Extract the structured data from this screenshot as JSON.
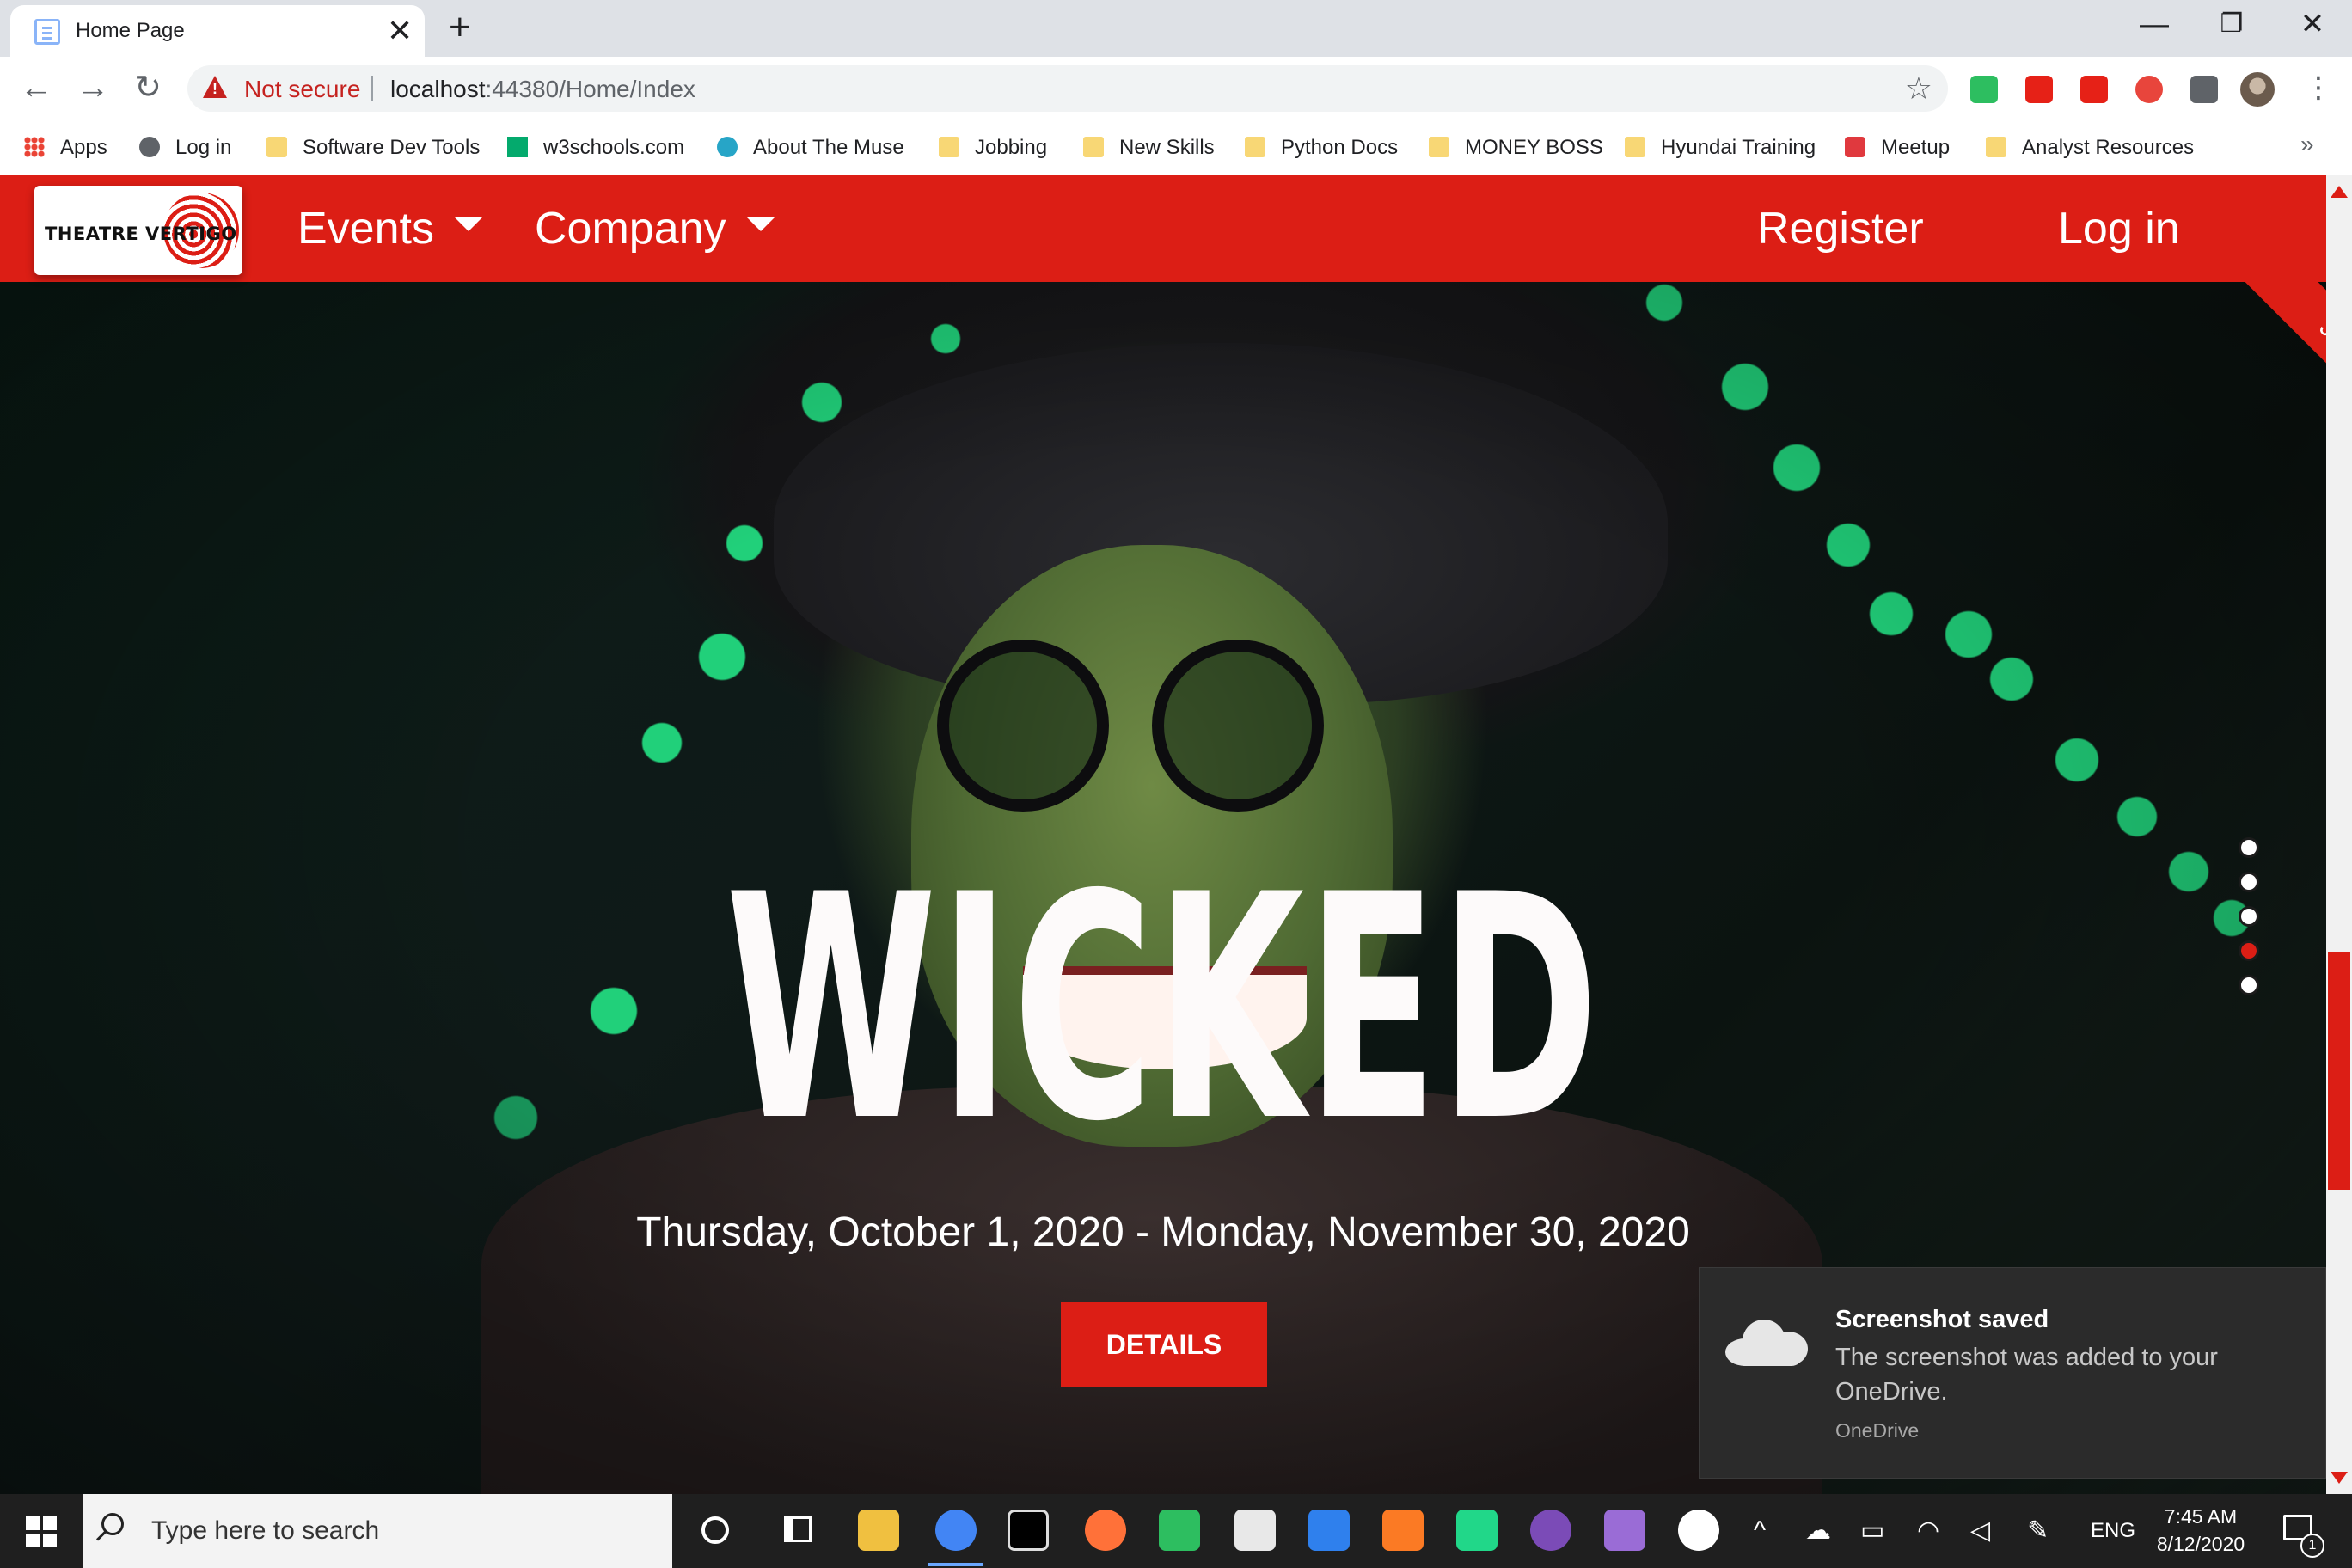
{
  "browser": {
    "tab_title": "Home Page",
    "new_tab_glyph": "+",
    "close_tab_glyph": "✕",
    "window_controls": {
      "minimize": "—",
      "restore": "❐",
      "close": "✕"
    },
    "nav": {
      "back": "←",
      "forward": "→",
      "reload": "↻"
    },
    "security_label": "Not secure",
    "url_host": "localhost",
    "url_rest": ":44380/Home/Index",
    "star_glyph": "☆",
    "menu_glyph": "⋮",
    "extensions": [
      {
        "name": "evernote-extension-icon",
        "color": "#2dbe60"
      },
      {
        "name": "youtube-extension-icon",
        "color": "#e62117"
      },
      {
        "name": "youtube-alt-extension-icon",
        "color": "#e62117"
      },
      {
        "name": "record-extension-icon",
        "color": "#e8453c"
      },
      {
        "name": "puzzle-extensions-icon",
        "color": "#5f6368"
      }
    ]
  },
  "bookmarks": {
    "items": [
      {
        "label": "Apps",
        "icon": "apps-grid-icon"
      },
      {
        "label": "Log in",
        "icon": "globe-icon"
      },
      {
        "label": "Software Dev Tools",
        "icon": "folder-icon"
      },
      {
        "label": "w3schools.com",
        "icon": "w3schools-icon"
      },
      {
        "label": "About The Muse",
        "icon": "muse-icon"
      },
      {
        "label": "Jobbing",
        "icon": "folder-icon"
      },
      {
        "label": "New Skills",
        "icon": "folder-icon"
      },
      {
        "label": "Python Docs",
        "icon": "folder-icon"
      },
      {
        "label": "MONEY BOSS",
        "icon": "folder-icon"
      },
      {
        "label": "Hyundai Training",
        "icon": "folder-icon"
      },
      {
        "label": "Meetup",
        "icon": "meetup-icon"
      },
      {
        "label": "Analyst Resources",
        "icon": "folder-icon"
      }
    ],
    "more_glyph": "»"
  },
  "site": {
    "logo_text": "THEATRE VERTIGO",
    "nav_left": [
      {
        "label": "Events"
      },
      {
        "label": "Company"
      }
    ],
    "nav_right": [
      {
        "label": "Register"
      },
      {
        "label": "Log in"
      }
    ],
    "ribbon_text": "Jon",
    "accent_color": "#dc1e15",
    "hero": {
      "title": "WICKED",
      "dates": "Thursday, October 1, 2020 - Monday, November 30, 2020",
      "button_label": "DETAILS"
    },
    "carousel": {
      "slide_count": 5,
      "active_index": 3
    }
  },
  "toast": {
    "title": "Screenshot saved",
    "body": "The screenshot was added to your OneDrive.",
    "source": "OneDrive"
  },
  "taskbar": {
    "search_placeholder": "Type here to search",
    "apps": [
      {
        "name": "file-explorer-icon",
        "color": "#f0c040"
      },
      {
        "name": "chrome-icon",
        "color": "#4285f4"
      },
      {
        "name": "terminal-icon",
        "color": "#000000"
      },
      {
        "name": "firefox-icon",
        "color": "#ff7139"
      },
      {
        "name": "evernote-icon",
        "color": "#2dbe60"
      },
      {
        "name": "notepad-icon",
        "color": "#e8e8e8"
      },
      {
        "name": "vscode-icon",
        "color": "#2f80ed"
      },
      {
        "name": "xampp-icon",
        "color": "#fb7a24"
      },
      {
        "name": "pycharm-icon",
        "color": "#21d789"
      },
      {
        "name": "github-icon",
        "color": "#7b4bb7"
      },
      {
        "name": "visual-studio-icon",
        "color": "#9a6cd6"
      },
      {
        "name": "slack-icon",
        "color": "#ffffff"
      }
    ],
    "language": "ENG",
    "time": "7:45 AM",
    "date": "8/12/2020",
    "notification_count": "1"
  }
}
